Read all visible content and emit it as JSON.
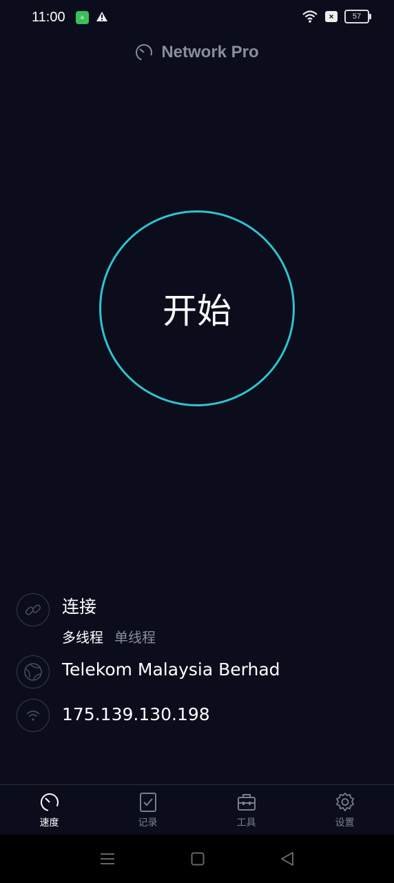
{
  "status_bar": {
    "time": "11:00",
    "battery": "57",
    "app_badge": "⛧"
  },
  "header": {
    "title": "Network Pro"
  },
  "start_button": {
    "label": "开始"
  },
  "connection": {
    "label": "连接",
    "thread_options": [
      "多线程",
      "单线程"
    ],
    "selected_thread": "多线程"
  },
  "isp": {
    "name": "Telekom Malaysia Berhad"
  },
  "ip": {
    "address": "175.139.130.198"
  },
  "bottom_nav": {
    "items": [
      {
        "label": "速度",
        "icon": "speedometer-icon",
        "active": true
      },
      {
        "label": "记录",
        "icon": "clipboard-check-icon",
        "active": false
      },
      {
        "label": "工具",
        "icon": "toolbox-icon",
        "active": false
      },
      {
        "label": "设置",
        "icon": "gear-icon",
        "active": false
      }
    ]
  },
  "colors": {
    "background": "#0b0d1c",
    "accent": "#2fc4cf",
    "muted": "#8a8d9c"
  }
}
